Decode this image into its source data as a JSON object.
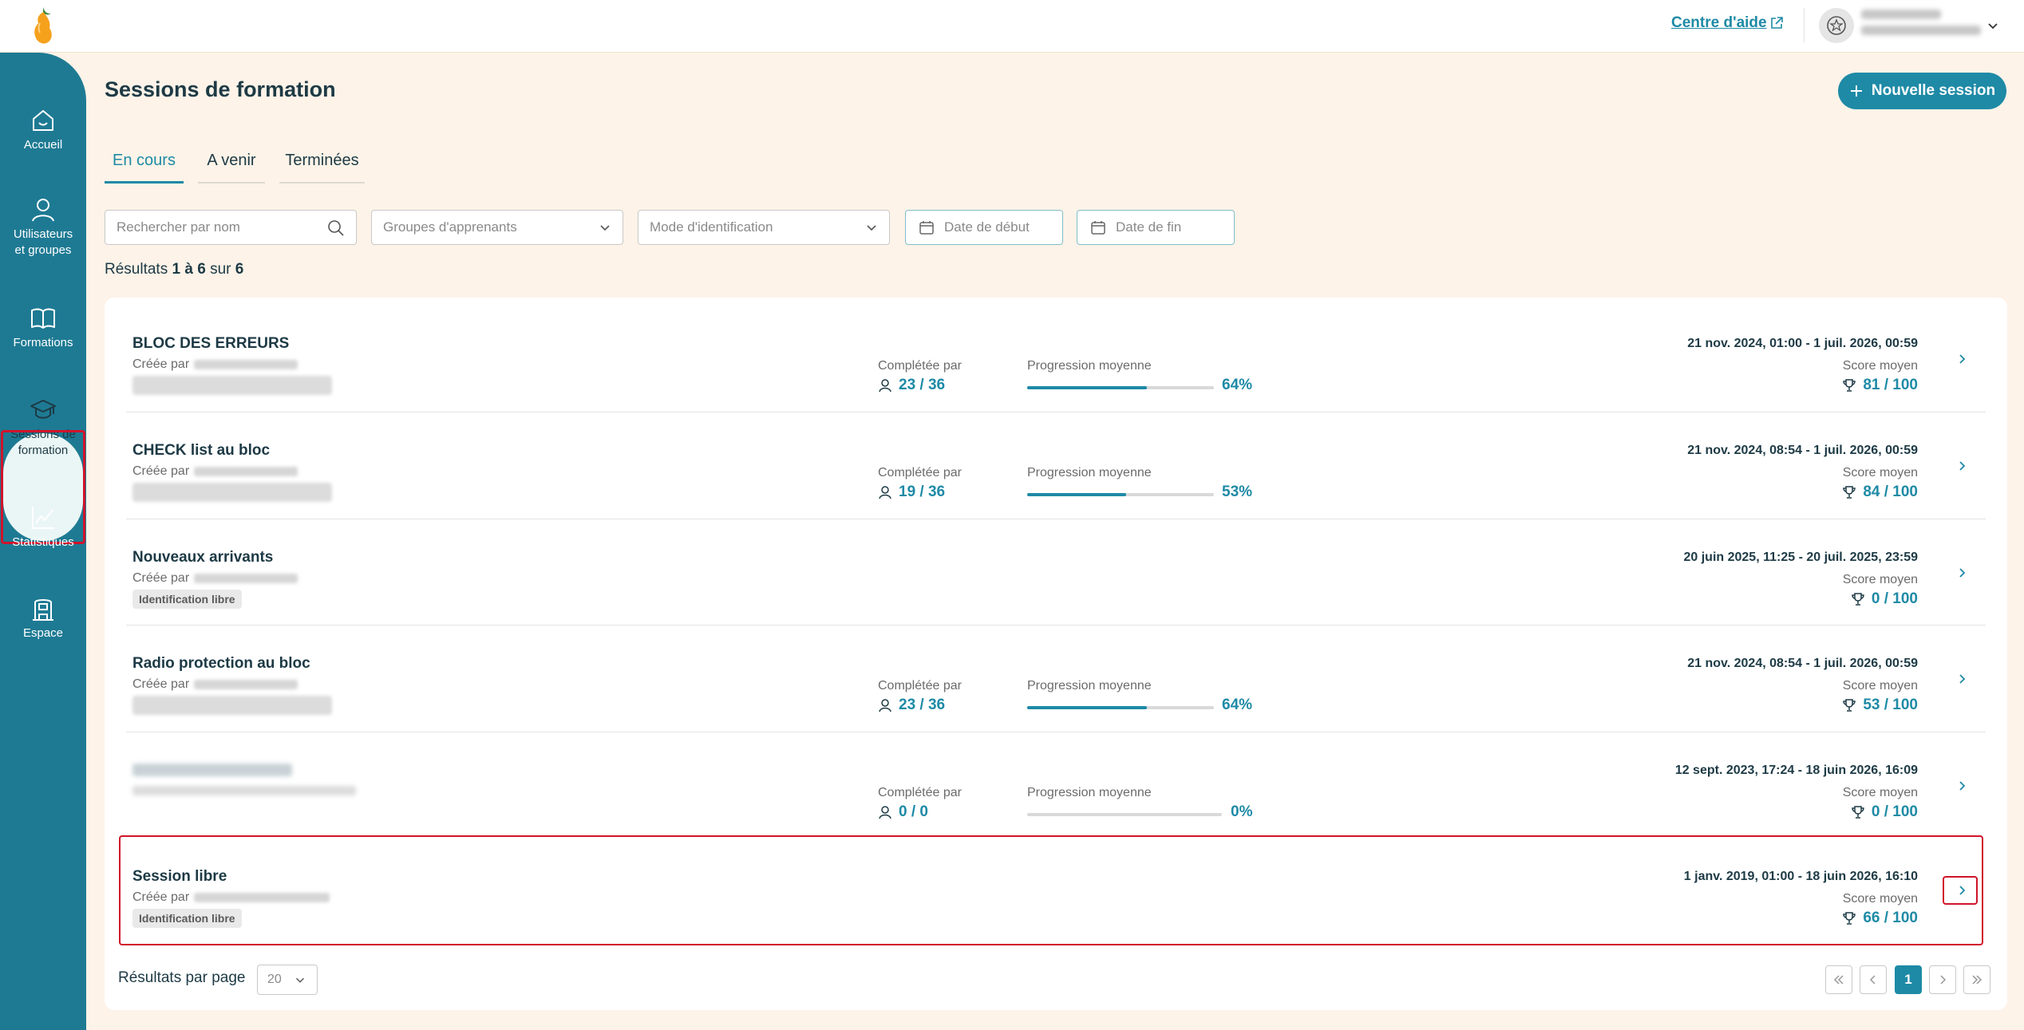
{
  "header": {
    "help_label": "Centre d'aide"
  },
  "sidebar": {
    "items": [
      {
        "label_lines": [
          "Accueil"
        ]
      },
      {
        "label_lines": [
          "Utilisateurs",
          "et groupes"
        ]
      },
      {
        "label_lines": [
          "Formations"
        ]
      },
      {
        "label_lines": [
          "Sessions de",
          "formation"
        ]
      },
      {
        "label_lines": [
          "Statistiques"
        ]
      },
      {
        "label_lines": [
          "Espace"
        ]
      }
    ]
  },
  "page": {
    "title": "Sessions de formation",
    "new_button": "Nouvelle session"
  },
  "tabs": [
    "En cours",
    "A venir",
    "Terminées"
  ],
  "filters": {
    "search_placeholder": "Rechercher par nom",
    "groups": "Groupes d'apprenants",
    "identification": "Mode d'identification",
    "start_date": "Date de début",
    "end_date": "Date de fin"
  },
  "results": {
    "prefix": "Résultats",
    "from": "1",
    "to_word": "à",
    "to": "6",
    "of_word": "sur",
    "total": "6"
  },
  "labels": {
    "created_by": "Créée par",
    "completed_by": "Complétée par",
    "avg_progress": "Progression moyenne",
    "avg_score": "Score moyen"
  },
  "sessions": [
    {
      "title": "BLOC DES ERREURS",
      "chip": "",
      "completed": "23 / 36",
      "progress_pct": "64%",
      "progress": 0.64,
      "dates": "21 nov. 2024, 01:00 - 1 juil. 2026, 00:59",
      "score": "81 / 100"
    },
    {
      "title": "CHECK list au bloc",
      "chip": "",
      "completed": "19 / 36",
      "progress_pct": "53%",
      "progress": 0.53,
      "dates": "21 nov. 2024, 08:54 - 1 juil. 2026, 00:59",
      "score": "84 / 100"
    },
    {
      "title": "Nouveaux arrivants",
      "chip": "Identification libre",
      "completed": "",
      "progress_pct": "",
      "progress": null,
      "dates": "20 juin 2025, 11:25 - 20 juil. 2025, 23:59",
      "score": "0 / 100"
    },
    {
      "title": "Radio protection au bloc",
      "chip": "",
      "completed": "23 / 36",
      "progress_pct": "64%",
      "progress": 0.64,
      "dates": "21 nov. 2024, 08:54 - 1 juil. 2026, 00:59",
      "score": "53 / 100"
    },
    {
      "title": "",
      "chip": "",
      "completed": "0 / 0",
      "progress_pct": "0%",
      "progress": 0,
      "dates": "12 sept. 2023, 17:24 - 18 juin 2026, 16:09",
      "score": "0 / 100"
    },
    {
      "title": "Session libre",
      "chip": "Identification libre",
      "completed": "",
      "progress_pct": "",
      "progress": null,
      "dates": "1 janv. 2019, 01:00 - 18 juin 2026, 16:10",
      "score": "66 / 100"
    }
  ],
  "pagination": {
    "per_page_label": "Résultats par page",
    "per_page": "20",
    "current_page": "1"
  },
  "colors": {
    "accent": "#1e8aa6",
    "sidebar": "#1e7a93",
    "background": "#fdf3e8",
    "highlight": "#d0142b"
  }
}
